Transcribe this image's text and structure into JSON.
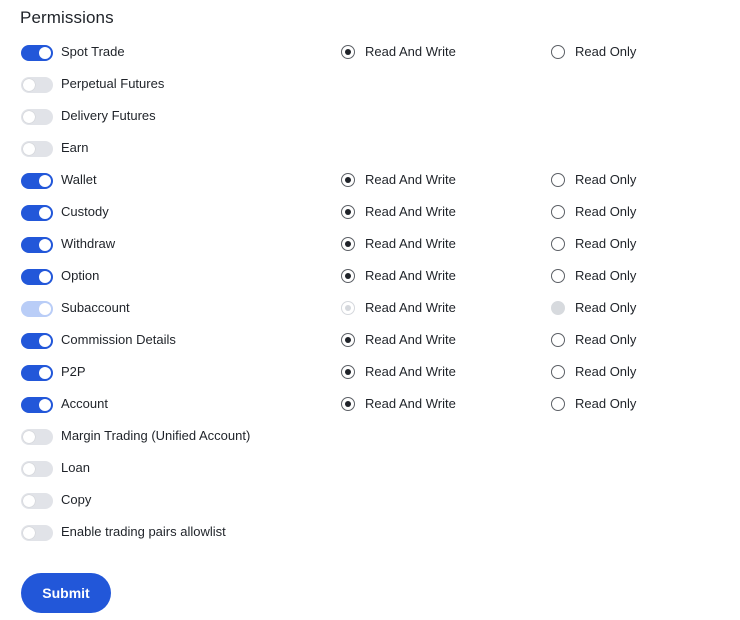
{
  "title": "Permissions",
  "read_write_label": "Read And Write",
  "read_only_label": "Read Only",
  "submit_label": "Submit",
  "colors": {
    "accent": "#2257d9",
    "accent_disabled": "#b9cdf7",
    "toggle_off": "#e1e3e8"
  },
  "permissions": [
    {
      "label": "Spot Trade",
      "enabled": true,
      "disabled": false,
      "access": "read_write"
    },
    {
      "label": "Perpetual Futures",
      "enabled": false,
      "disabled": false,
      "access": null
    },
    {
      "label": "Delivery Futures",
      "enabled": false,
      "disabled": false,
      "access": null
    },
    {
      "label": "Earn",
      "enabled": false,
      "disabled": false,
      "access": null
    },
    {
      "label": "Wallet",
      "enabled": true,
      "disabled": false,
      "access": "read_write"
    },
    {
      "label": "Custody",
      "enabled": true,
      "disabled": false,
      "access": "read_write"
    },
    {
      "label": "Withdraw",
      "enabled": true,
      "disabled": false,
      "access": "read_write"
    },
    {
      "label": "Option",
      "enabled": true,
      "disabled": false,
      "access": "read_write"
    },
    {
      "label": "Subaccount",
      "enabled": true,
      "disabled": true,
      "access": "read_write"
    },
    {
      "label": "Commission Details",
      "enabled": true,
      "disabled": false,
      "access": "read_write"
    },
    {
      "label": "P2P",
      "enabled": true,
      "disabled": false,
      "access": "read_write"
    },
    {
      "label": "Account",
      "enabled": true,
      "disabled": false,
      "access": "read_write"
    },
    {
      "label": "Margin Trading (Unified Account)",
      "enabled": false,
      "disabled": false,
      "access": null
    },
    {
      "label": "Loan",
      "enabled": false,
      "disabled": false,
      "access": null
    },
    {
      "label": "Copy",
      "enabled": false,
      "disabled": false,
      "access": null
    },
    {
      "label": "Enable trading pairs allowlist",
      "enabled": false,
      "disabled": false,
      "access": null
    }
  ]
}
